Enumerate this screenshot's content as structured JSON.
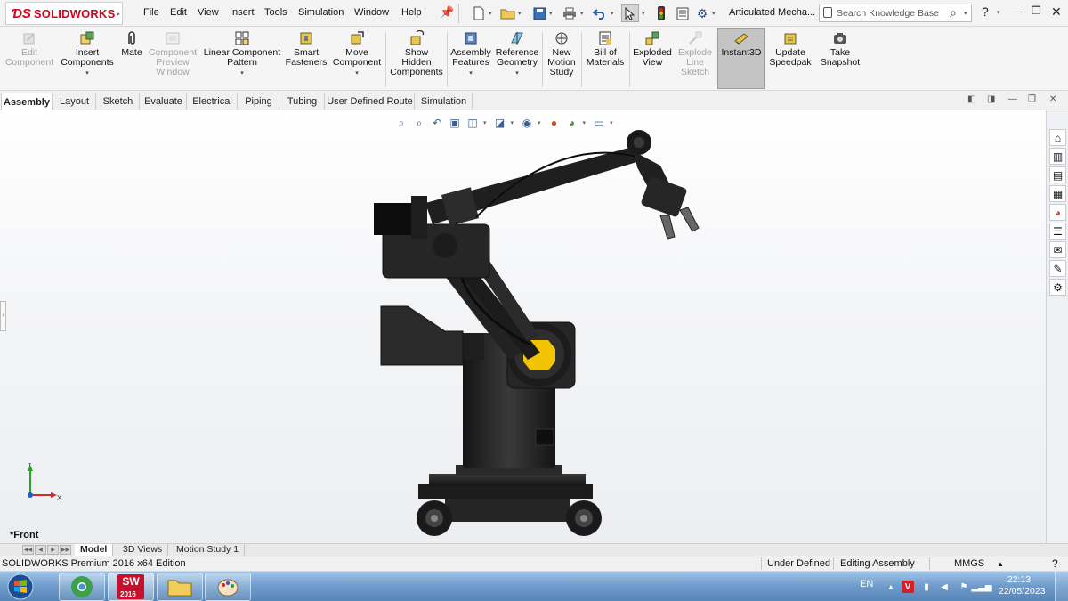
{
  "app": {
    "brand": "SOLIDWORKS",
    "document_title": "Articulated Mecha..."
  },
  "menu": [
    "File",
    "Edit",
    "View",
    "Insert",
    "Tools",
    "Simulation",
    "Window",
    "Help"
  ],
  "search": {
    "placeholder": "Search Knowledge Base"
  },
  "help_label": "?",
  "command_manager": [
    {
      "label": "Edit Component",
      "enabled": false,
      "icon": "edit-component-icon"
    },
    {
      "label": "Insert Components",
      "enabled": true,
      "icon": "insert-components-icon",
      "dropdown": true
    },
    {
      "label": "Mate",
      "enabled": true,
      "icon": "mate-paperclip-icon"
    },
    {
      "label": "Component Preview Window",
      "enabled": false,
      "icon": "component-preview-icon"
    },
    {
      "label": "Linear Component Pattern",
      "enabled": true,
      "icon": "linear-pattern-icon",
      "dropdown": true
    },
    {
      "label": "Smart Fasteners",
      "enabled": true,
      "icon": "smart-fasteners-icon"
    },
    {
      "label": "Move Component",
      "enabled": true,
      "icon": "move-component-icon",
      "dropdown": true
    },
    {
      "label": "Show Hidden Components",
      "enabled": true,
      "icon": "show-hidden-icon"
    },
    {
      "label": "Assembly Features",
      "enabled": true,
      "icon": "assembly-features-icon",
      "dropdown": true
    },
    {
      "label": "Reference Geometry",
      "enabled": true,
      "icon": "reference-geometry-icon",
      "dropdown": true
    },
    {
      "label": "New Motion Study",
      "enabled": true,
      "icon": "new-motion-study-icon"
    },
    {
      "label": "Bill of Materials",
      "enabled": true,
      "icon": "bill-of-materials-icon"
    },
    {
      "label": "Exploded View",
      "enabled": true,
      "icon": "exploded-view-icon"
    },
    {
      "label": "Explode Line Sketch",
      "enabled": false,
      "icon": "explode-line-sketch-icon"
    },
    {
      "label": "Instant3D",
      "enabled": true,
      "active": true,
      "icon": "instant3d-icon"
    },
    {
      "label": "Update Speedpak",
      "enabled": true,
      "icon": "update-speedpak-icon"
    },
    {
      "label": "Take Snapshot",
      "enabled": true,
      "icon": "take-snapshot-icon"
    }
  ],
  "tabs": [
    "Assembly",
    "Layout",
    "Sketch",
    "Evaluate",
    "Electrical",
    "Piping",
    "Tubing",
    "User Defined Route",
    "Simulation"
  ],
  "active_tab": "Assembly",
  "viewport": {
    "view_name": "*Front",
    "triad_labels": {
      "x": "X",
      "y": "Y"
    }
  },
  "model_tabs": [
    "Model",
    "3D Views",
    "Motion Study 1"
  ],
  "active_model_tab": "Model",
  "status": {
    "edition": "SOLIDWORKS Premium 2016 x64 Edition",
    "definition": "Under Defined",
    "mode": "Editing Assembly",
    "units": "MMGS"
  },
  "taskbar": {
    "apps": [
      "start-orb",
      "chrome-browser",
      "solidworks-2016",
      "file-explorer",
      "paint"
    ],
    "solidworks_badge": "2016",
    "language": "EN",
    "time": "22:13",
    "date": "22/05/2023"
  },
  "colors": {
    "brand_red": "#d7001f",
    "model_black": "#1f1f1f",
    "joint_yellow": "#f2c400",
    "taskbar_blue": "#6f9ccb"
  }
}
